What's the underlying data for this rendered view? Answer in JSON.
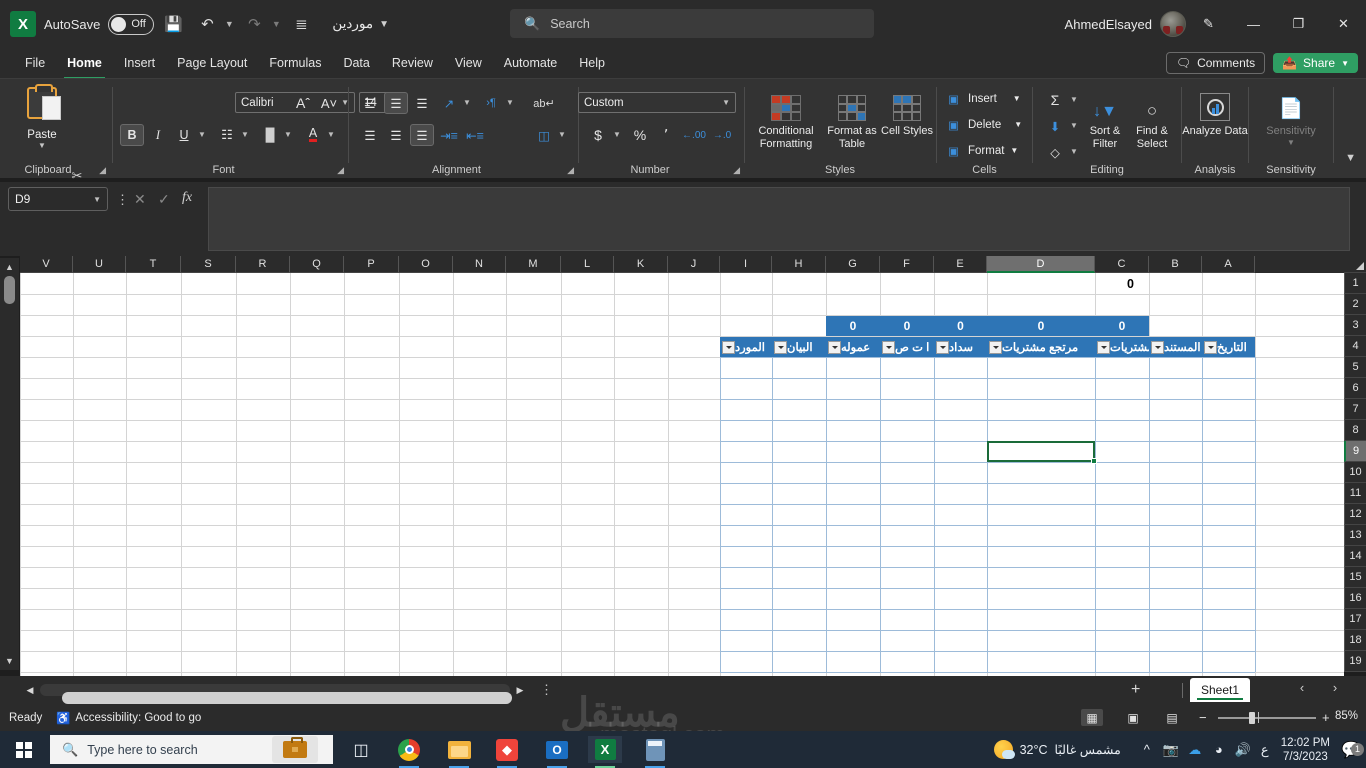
{
  "titlebar": {
    "autosave_label": "AutoSave",
    "autosave_state": "Off",
    "save_icon": "save-icon",
    "undo_icon": "undo-icon",
    "redo_icon": "redo-icon",
    "customize_icon": "customize-quick-access-icon",
    "document_title": "موردين",
    "username": "AhmedElsayed",
    "minimize": "—",
    "restore": "❐",
    "close": "✕"
  },
  "search": {
    "placeholder": "Search",
    "icon": "search-icon"
  },
  "ribbon_tabs": [
    {
      "label": "File",
      "active": false
    },
    {
      "label": "Home",
      "active": true
    },
    {
      "label": "Insert",
      "active": false
    },
    {
      "label": "Page Layout",
      "active": false
    },
    {
      "label": "Formulas",
      "active": false
    },
    {
      "label": "Data",
      "active": false
    },
    {
      "label": "Review",
      "active": false
    },
    {
      "label": "View",
      "active": false
    },
    {
      "label": "Automate",
      "active": false
    },
    {
      "label": "Help",
      "active": false
    }
  ],
  "ribbon_right": {
    "comments_label": "Comments",
    "share_label": "Share"
  },
  "ribbon": {
    "clipboard": {
      "group_label": "Clipboard",
      "paste_label": "Paste",
      "cut_icon": "scissors-icon",
      "copy_icon": "copy-icon",
      "format_painter_icon": "format-painter-icon"
    },
    "font": {
      "group_label": "Font",
      "font_name": "Calibri",
      "font_size": "14",
      "grow_font": "A",
      "shrink_font": "A",
      "bold": "B",
      "italic": "I",
      "underline": "U",
      "borders_icon": "borders-icon",
      "fill_color_icon": "fill-color-icon",
      "font_color_icon": "font-color-icon"
    },
    "alignment": {
      "group_label": "Alignment",
      "top_align": "top-align-icon",
      "middle_align": "middle-align-icon",
      "bottom_align": "bottom-align-icon",
      "orientation": "orientation-icon",
      "rtl_text": "text-direction-icon",
      "align_left": "align-left-icon",
      "align_center": "align-center-icon",
      "align_right": "align-right-icon",
      "increase_indent": "increase-indent-icon",
      "decrease_indent": "decrease-indent-icon",
      "wrap_text": "wrap-text-icon",
      "merge_center": "merge-and-center-icon"
    },
    "number": {
      "group_label": "Number",
      "format": "Custom",
      "currency": "$",
      "percent": "%",
      "comma": "٬",
      "increase_decimal": "increase-decimal-icon",
      "decrease_decimal": "decrease-decimal-icon"
    },
    "styles": {
      "group_label": "Styles",
      "conditional_formatting": "Conditional Formatting",
      "format_as_table": "Format as Table",
      "cell_styles": "Cell Styles"
    },
    "cells": {
      "group_label": "Cells",
      "insert": "Insert",
      "delete": "Delete",
      "format": "Format"
    },
    "editing": {
      "group_label": "Editing",
      "autosum": "autosum-icon",
      "fill": "fill-icon",
      "clear": "clear-icon",
      "sort_filter": "Sort & Filter",
      "find_select": "Find & Select"
    },
    "analysis": {
      "group_label": "Analysis",
      "analyze_data": "Analyze Data"
    },
    "sensitivity": {
      "group_label": "Sensitivity",
      "label": "Sensitivity"
    },
    "collapse_icon": "collapse-ribbon-icon"
  },
  "formula_bar": {
    "name_box": "D9",
    "cancel_icon": "cancel-icon",
    "enter_icon": "enter-icon",
    "function_icon": "fx",
    "value": "",
    "expand_icon": "expand-formula-bar-icon"
  },
  "grid": {
    "columns": [
      "V",
      "U",
      "T",
      "S",
      "R",
      "Q",
      "P",
      "O",
      "N",
      "M",
      "L",
      "K",
      "J",
      "I",
      "H",
      "G",
      "F",
      "E",
      "D",
      "C",
      "B",
      "A"
    ],
    "selected_column": "D",
    "rows": [
      "1",
      "2",
      "3",
      "4",
      "5",
      "6",
      "7",
      "8",
      "9",
      "10",
      "11",
      "12",
      "13",
      "14",
      "15",
      "16",
      "17",
      "18",
      "19"
    ],
    "selected_row": "9",
    "top_value": "0",
    "sum_row": [
      "0",
      "0",
      "0",
      "0",
      "0"
    ],
    "table_headers": [
      "التاريخ",
      "رقم المستند",
      "مشتريات",
      "مرتجع مشتريات",
      "سداد",
      "ا ت ص",
      "عموله",
      "البيان",
      "المورد"
    ],
    "active_cell": "D9"
  },
  "sheet_tabs": {
    "add_sheet": "+",
    "tabs": [
      "Sheet1"
    ],
    "active": "Sheet1",
    "prev_icon": "previous-sheet-icon",
    "next_icon": "next-sheet-icon"
  },
  "status_bar": {
    "ready": "Ready",
    "accessibility": "Accessibility: Good to go",
    "view_normal": "normal-view-icon",
    "view_pagelayout": "page-layout-view-icon",
    "view_pagebreak": "page-break-preview-icon",
    "zoom_out": "−",
    "zoom_in": "+",
    "zoom_level": "85%"
  },
  "taskbar": {
    "start_icon": "windows-start-icon",
    "search_placeholder": "Type here to search",
    "cortana_icon": "briefcase-icon",
    "task_view_icon": "task-view-icon",
    "apps": [
      "chrome-icon",
      "file-explorer-icon",
      "anydesk-icon",
      "outlook-icon",
      "excel-icon",
      "calculator-icon"
    ],
    "weather_temp": "32°C",
    "weather_desc": "مشمس غالبًا",
    "tray_icons": [
      "chevron-up-icon",
      "camera-icon",
      "onedrive-icon",
      "wifi-icon",
      "volume-icon"
    ],
    "language": "ع",
    "time": "12:02 PM",
    "date": "7/3/2023",
    "notification_count": "1"
  },
  "watermark": {
    "text_ar": "مستقل",
    "text_en": "mostaql.com"
  }
}
